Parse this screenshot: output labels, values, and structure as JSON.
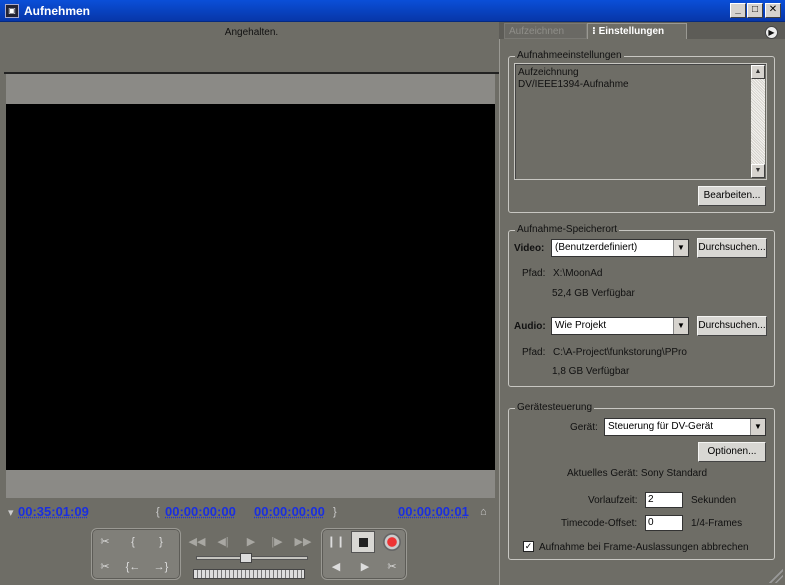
{
  "window": {
    "title": "Aufnehmen",
    "min": "_",
    "max": "□",
    "close": "✕"
  },
  "monitor": {
    "status": "Angehalten."
  },
  "timecodes": {
    "current": "00:35:01:09",
    "in_point": "00:00:00:00",
    "out_point": "00:00:00:00",
    "duration": "00:00:00:01"
  },
  "tabs": {
    "protocol": "Aufzeichnen",
    "settings": "Einstellungen"
  },
  "capture_settings": {
    "legend": "Aufnahmeeinstellungen",
    "lines": [
      "Aufzeichnung",
      " DV/IEEE1394-Aufnahme"
    ],
    "edit_button": "Bearbeiten..."
  },
  "storage": {
    "legend": "Aufnahme-Speicherort",
    "video_label": "Video:",
    "video_value": "(Benutzerdefiniert)",
    "video_path_label": "Pfad:",
    "video_path": "X:\\MoonAd",
    "video_free": "52,4 GB Verfügbar",
    "audio_label": "Audio:",
    "audio_value": "Wie Projekt",
    "audio_path_label": "Pfad:",
    "audio_path": "C:\\A-Project\\funkstorung\\PPro",
    "audio_free": "1,8 GB Verfügbar",
    "browse_button": "Durchsuchen..."
  },
  "device": {
    "legend": "Gerätesteuerung",
    "device_label": "Gerät:",
    "device_value": "Steuerung für DV-Gerät",
    "options_button": "Optionen...",
    "current_device": "Aktuelles Gerät: Sony Standard",
    "preroll_label": "Vorlaufzeit:",
    "preroll_value": "2",
    "preroll_unit": "Sekunden",
    "tc_offset_label": "Timecode-Offset:",
    "tc_offset_value": "0",
    "tc_offset_unit": "1/4-Frames",
    "abort_label": "Aufnahme bei Frame-Auslassungen abbrechen",
    "abort_checked": true
  }
}
